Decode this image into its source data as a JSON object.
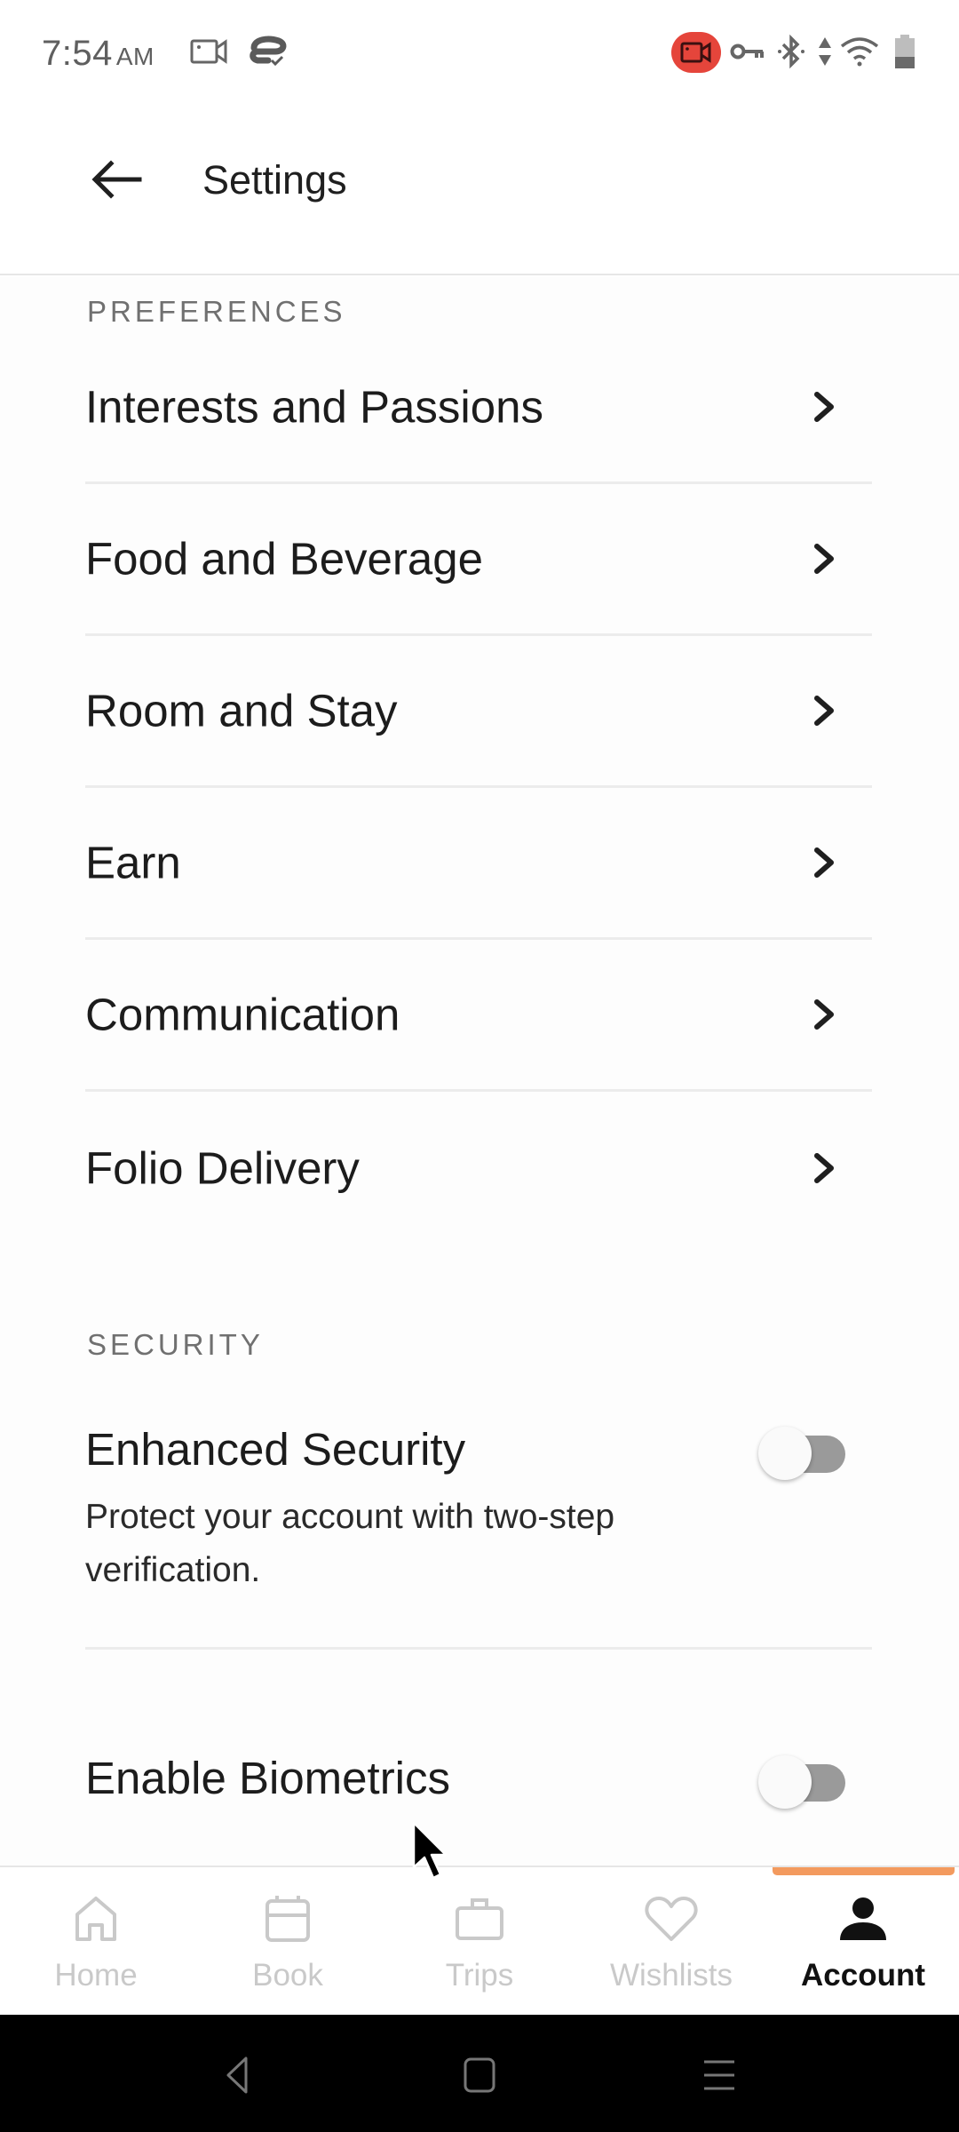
{
  "status_bar": {
    "time": "7:54",
    "ampm": "AM",
    "left_icons": [
      "screen-record-icon",
      "vpn-app-icon"
    ],
    "right_icons": [
      "recording-active-icon",
      "vpn-key-icon",
      "bluetooth-icon",
      "data-arrows-icon",
      "wifi-icon",
      "battery-icon"
    ],
    "recording_color": "#e5453b"
  },
  "header": {
    "back_icon": "arrow-left-icon",
    "title": "Settings"
  },
  "preferences": {
    "section_label": "PREFERENCES",
    "items": [
      {
        "label": "Interests and Passions",
        "icon": "chevron-right-icon"
      },
      {
        "label": "Food and Beverage",
        "icon": "chevron-right-icon"
      },
      {
        "label": "Room and Stay",
        "icon": "chevron-right-icon"
      },
      {
        "label": "Earn",
        "icon": "chevron-right-icon"
      },
      {
        "label": "Communication",
        "icon": "chevron-right-icon"
      },
      {
        "label": "Folio Delivery",
        "icon": "chevron-right-icon"
      }
    ]
  },
  "security": {
    "section_label": "SECURITY",
    "items": [
      {
        "title": "Enhanced Security",
        "description": "Protect your account with two-step verification.",
        "enabled": false
      },
      {
        "title": "Enable Biometrics",
        "enabled": false
      }
    ]
  },
  "bottom_nav": {
    "accent_color": "#f39a5e",
    "tabs": [
      {
        "label": "Home",
        "icon": "home-icon",
        "active": false
      },
      {
        "label": "Book",
        "icon": "calendar-icon",
        "active": false
      },
      {
        "label": "Trips",
        "icon": "briefcase-icon",
        "active": false
      },
      {
        "label": "Wishlists",
        "icon": "heart-icon",
        "active": false
      },
      {
        "label": "Account",
        "icon": "person-icon",
        "active": true
      }
    ]
  },
  "system_nav": {
    "buttons": [
      "back",
      "home",
      "recents"
    ]
  }
}
